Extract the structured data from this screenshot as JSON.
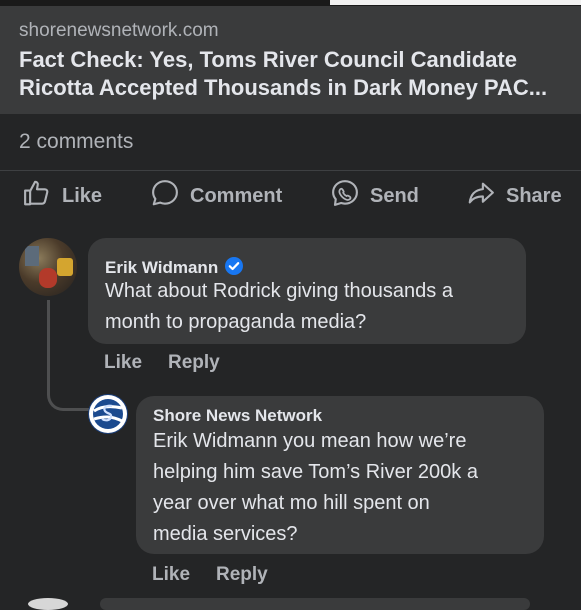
{
  "link_preview": {
    "domain": "shorenewsnetwork.com",
    "title": "Fact Check: Yes, Toms River Council Candidate Ricotta Accepted Thousands in Dark Money PAC..."
  },
  "comments_count": "2 comments",
  "actions": {
    "like": "Like",
    "comment": "Comment",
    "send": "Send",
    "share": "Share"
  },
  "comments": [
    {
      "author": "Erik Widmann",
      "verified": true,
      "text_lines": [
        "What about Rodrick giving thousands a",
        "month to propaganda media?"
      ],
      "like": "Like",
      "reply": "Reply"
    },
    {
      "author": "Shore News Network",
      "text_lines": [
        "Erik Widmann you mean how we’re",
        "helping him save Tom’s River 200k a",
        "year over what mo hill spent on",
        "media services?"
      ],
      "like": "Like",
      "reply": "Reply"
    }
  ],
  "colors": {
    "background": "#242526",
    "bubble": "#3a3b3c",
    "text_primary": "#e4e6eb",
    "text_secondary": "#b0b3b8",
    "verified_badge": "#1877f2"
  }
}
